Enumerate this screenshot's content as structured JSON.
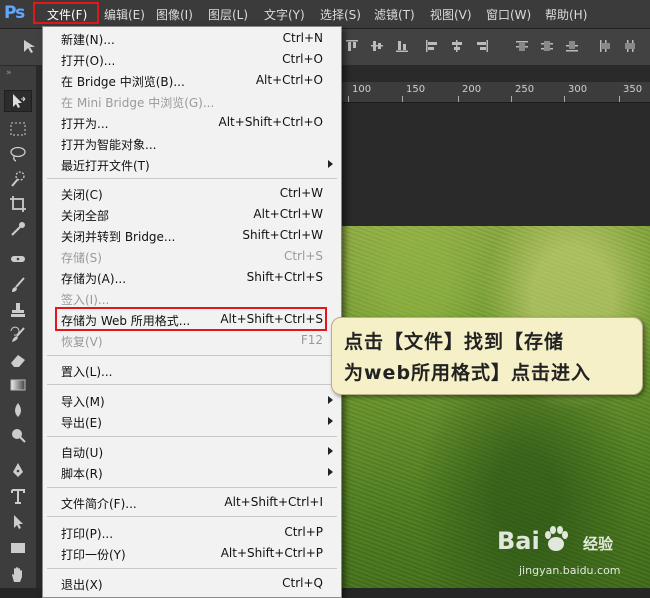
{
  "app": {
    "logo": "Ps"
  },
  "menubar": {
    "items": [
      "文件(F)",
      "编辑(E)",
      "图像(I)",
      "图层(L)",
      "文字(Y)",
      "选择(S)",
      "滤镜(T)",
      "视图(V)",
      "窗口(W)",
      "帮助(H)"
    ],
    "active_index": 0
  },
  "ruler": {
    "ticks": [
      "100",
      "150",
      "200",
      "250",
      "300",
      "350"
    ]
  },
  "file_menu": {
    "items": [
      {
        "label": "新建(N)...",
        "shortcut": "Ctrl+N",
        "disabled": false
      },
      {
        "label": "打开(O)...",
        "shortcut": "Ctrl+O",
        "disabled": false
      },
      {
        "label": "在 Bridge 中浏览(B)...",
        "shortcut": "Alt+Ctrl+O",
        "disabled": false
      },
      {
        "label": "在 Mini Bridge 中浏览(G)...",
        "shortcut": "",
        "disabled": true
      },
      {
        "label": "打开为...",
        "shortcut": "Alt+Shift+Ctrl+O",
        "disabled": false
      },
      {
        "label": "打开为智能对象...",
        "shortcut": "",
        "disabled": false
      },
      {
        "label": "最近打开文件(T)",
        "shortcut": "",
        "disabled": false,
        "submenu": true
      },
      {
        "label": "关闭(C)",
        "shortcut": "Ctrl+W",
        "disabled": false
      },
      {
        "label": "关闭全部",
        "shortcut": "Alt+Ctrl+W",
        "disabled": false
      },
      {
        "label": "关闭并转到 Bridge...",
        "shortcut": "Shift+Ctrl+W",
        "disabled": false
      },
      {
        "label": "存储(S)",
        "shortcut": "Ctrl+S",
        "disabled": true
      },
      {
        "label": "存储为(A)...",
        "shortcut": "Shift+Ctrl+S",
        "disabled": false
      },
      {
        "label": "签入(I)...",
        "shortcut": "",
        "disabled": true
      },
      {
        "label": "存储为 Web 所用格式...",
        "shortcut": "Alt+Shift+Ctrl+S",
        "disabled": false,
        "highlighted": true
      },
      {
        "label": "恢复(V)",
        "shortcut": "F12",
        "disabled": true
      },
      {
        "label": "置入(L)...",
        "shortcut": "",
        "disabled": false
      },
      {
        "label": "导入(M)",
        "shortcut": "",
        "disabled": false,
        "submenu": true
      },
      {
        "label": "导出(E)",
        "shortcut": "",
        "disabled": false,
        "submenu": true
      },
      {
        "label": "自动(U)",
        "shortcut": "",
        "disabled": false,
        "submenu": true
      },
      {
        "label": "脚本(R)",
        "shortcut": "",
        "disabled": false,
        "submenu": true
      },
      {
        "label": "文件简介(F)...",
        "shortcut": "Alt+Shift+Ctrl+I",
        "disabled": false
      },
      {
        "label": "打印(P)...",
        "shortcut": "Ctrl+P",
        "disabled": false
      },
      {
        "label": "打印一份(Y)",
        "shortcut": "Alt+Shift+Ctrl+P",
        "disabled": false
      },
      {
        "label": "退出(X)",
        "shortcut": "Ctrl+Q",
        "disabled": false
      }
    ]
  },
  "callout": {
    "line1": "点击【文件】找到【存储",
    "line2": "为web所用格式】点击进入"
  },
  "watermark": {
    "brand": "Bai",
    "brand2": "经验",
    "url": "jingyan.baidu.com"
  },
  "colors": {
    "highlight_red": "#e0171b",
    "menubar_bg": "#3b3b3b",
    "menu_bg": "#f2f2f2",
    "callout_bg": "#f5f0c8"
  },
  "icons": [
    "move-icon",
    "marquee-icon",
    "lasso-icon",
    "quick-select-icon",
    "crop-icon",
    "eyedropper-icon",
    "healing-icon",
    "brush-icon",
    "stamp-icon",
    "history-brush-icon",
    "eraser-icon",
    "gradient-icon",
    "blur-icon",
    "dodge-icon",
    "pen-icon",
    "type-icon",
    "path-select-icon",
    "rectangle-icon",
    "hand-icon"
  ]
}
